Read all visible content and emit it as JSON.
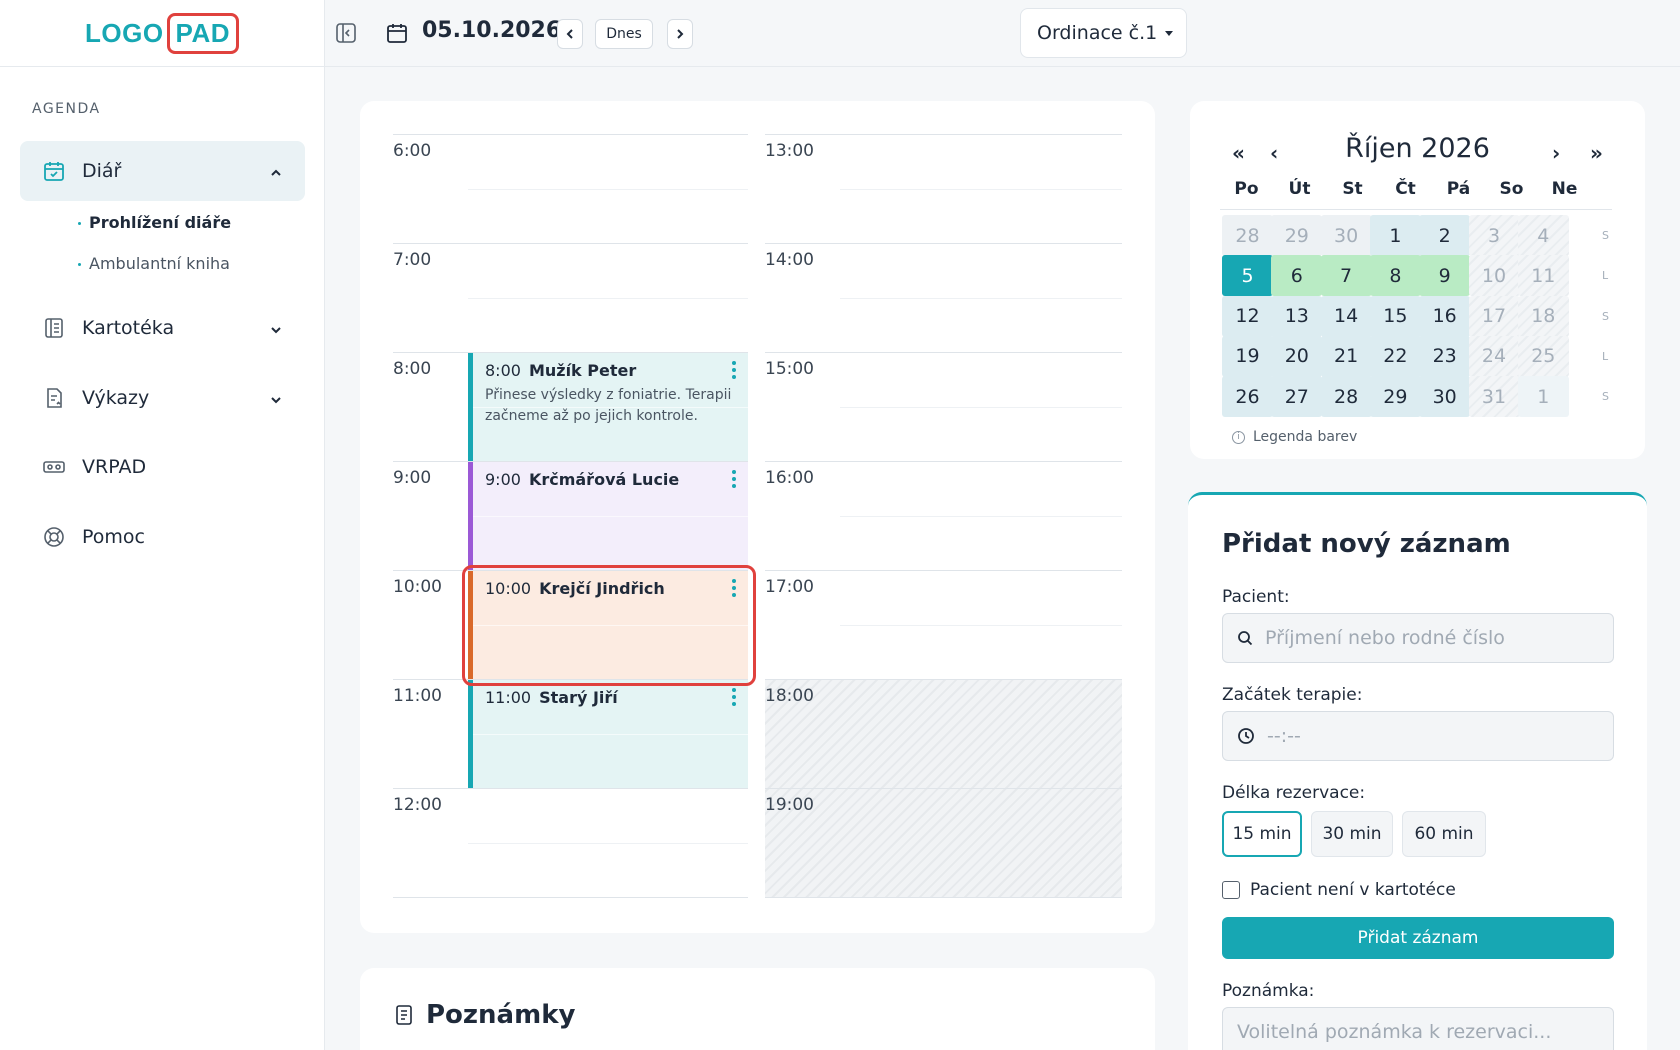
{
  "logo": {
    "part1": "LOGO",
    "part2": "PAD"
  },
  "sidebar": {
    "section_label": "AGENDA",
    "items": [
      {
        "label": "Diář",
        "icon": "calendar-check-icon"
      },
      {
        "label": "Kartotéka",
        "icon": "index-book-icon"
      },
      {
        "label": "Výkazy",
        "icon": "report-icon"
      },
      {
        "label": "VRPAD",
        "icon": "vr-headset-icon"
      },
      {
        "label": "Pomoc",
        "icon": "lifebuoy-icon"
      }
    ],
    "sub_items": [
      {
        "label": "Prohlížení diáře"
      },
      {
        "label": "Ambulantní kniha"
      }
    ]
  },
  "topbar": {
    "date": "05.10.2026",
    "today_label": "Dnes",
    "office": "Ordinace č.1"
  },
  "schedule": {
    "hours_left": [
      "6:00",
      "7:00",
      "8:00",
      "9:00",
      "10:00",
      "11:00",
      "12:00"
    ],
    "hours_right": [
      "13:00",
      "14:00",
      "15:00",
      "16:00",
      "17:00",
      "18:00",
      "19:00"
    ],
    "appointments": [
      {
        "time": "8:00",
        "name": "Mužík Peter",
        "note": "Přinese výsledky z foniatrie. Terapii začneme až po jejich kontrole.",
        "color": "#17a7b3",
        "bg": "#e4f4f4"
      },
      {
        "time": "9:00",
        "name": "Krčmářová Lucie",
        "note": "",
        "color": "#9b59d6",
        "bg": "#f3eefb"
      },
      {
        "time": "10:00",
        "name": "Krejčí Jindřich",
        "note": "",
        "color": "#d9692a",
        "bg": "#fcebe1"
      },
      {
        "time": "11:00",
        "name": "Starý Jiří",
        "note": "",
        "color": "#17a7b3",
        "bg": "#e4f4f4"
      }
    ]
  },
  "notes": {
    "title": "Poznámky"
  },
  "mini_calendar": {
    "title": "Říjen 2026",
    "nav": {
      "first": "«",
      "prev": "‹",
      "next": "›",
      "last": "»"
    },
    "weekdays": [
      "Po",
      "Út",
      "St",
      "Čt",
      "Pá",
      "So",
      "Ne"
    ],
    "weeks": [
      {
        "marker": "S",
        "days": [
          [
            "28",
            "other"
          ],
          [
            "29",
            "other"
          ],
          [
            "30",
            "other"
          ],
          [
            "1",
            "work"
          ],
          [
            "2",
            "work"
          ],
          [
            "3",
            "weekend"
          ],
          [
            "4",
            "weekend"
          ]
        ]
      },
      {
        "marker": "L",
        "days": [
          [
            "5",
            "today"
          ],
          [
            "6",
            "green"
          ],
          [
            "7",
            "green"
          ],
          [
            "8",
            "green"
          ],
          [
            "9",
            "green"
          ],
          [
            "10",
            "weekend"
          ],
          [
            "11",
            "weekend"
          ]
        ]
      },
      {
        "marker": "S",
        "days": [
          [
            "12",
            "work"
          ],
          [
            "13",
            "work"
          ],
          [
            "14",
            "work"
          ],
          [
            "15",
            "work"
          ],
          [
            "16",
            "work"
          ],
          [
            "17",
            "weekend"
          ],
          [
            "18",
            "weekend"
          ]
        ]
      },
      {
        "marker": "L",
        "days": [
          [
            "19",
            "work"
          ],
          [
            "20",
            "work"
          ],
          [
            "21",
            "work"
          ],
          [
            "22",
            "work"
          ],
          [
            "23",
            "work"
          ],
          [
            "24",
            "weekend"
          ],
          [
            "25",
            "weekend"
          ]
        ]
      },
      {
        "marker": "S",
        "days": [
          [
            "26",
            "work"
          ],
          [
            "27",
            "work"
          ],
          [
            "28",
            "work"
          ],
          [
            "29",
            "work"
          ],
          [
            "30",
            "work"
          ],
          [
            "31",
            "weekend"
          ],
          [
            "1",
            "light"
          ]
        ]
      }
    ],
    "legend_label": "Legenda barev"
  },
  "form": {
    "title": "Přidat nový záznam",
    "patient_label": "Pacient:",
    "patient_placeholder": "Příjmení nebo rodné číslo",
    "start_label": "Začátek terapie:",
    "start_placeholder": "--:--",
    "duration_label": "Délka rezervace:",
    "durations": [
      "15 min",
      "30 min",
      "60 min"
    ],
    "selected_duration": "15 min",
    "not_in_file_label": "Pacient není v kartotéce",
    "submit_label": "Přidat záznam",
    "note_label": "Poznámka:",
    "note_placeholder": "Volitelná poznámka k rezervaci..."
  },
  "colors": {
    "accent": "#17a7b3",
    "highlight": "#e0413d"
  }
}
